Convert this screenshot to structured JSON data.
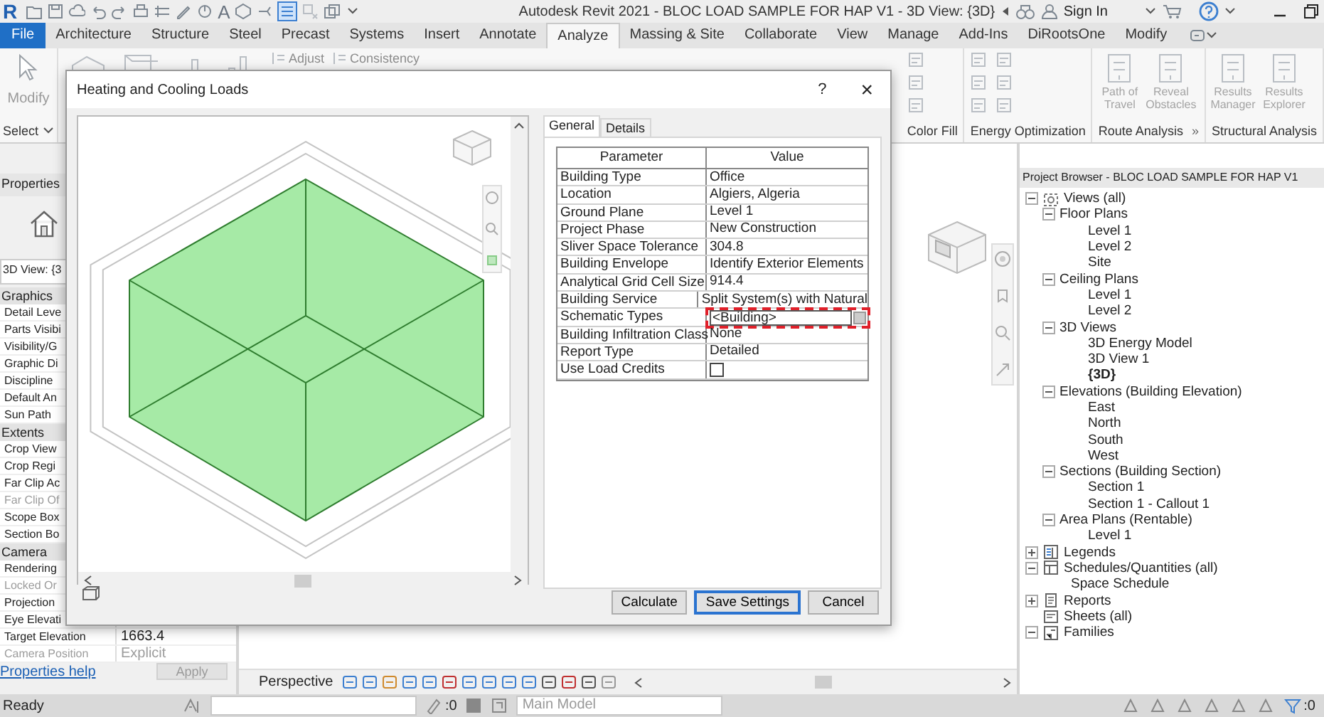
{
  "title_bar": {
    "logo": "R",
    "text_tool": "A",
    "title": "Autodesk Revit 2021 - BLOC LOAD SAMPLE FOR HAP V1 - 3D View: {3D}",
    "sign_in": "Sign In"
  },
  "ribbon_tabs": [
    {
      "label": "File",
      "kind": "app",
      "selected": false
    },
    {
      "label": "Architecture",
      "kind": "tab",
      "selected": false
    },
    {
      "label": "Structure",
      "kind": "tab",
      "selected": false
    },
    {
      "label": "Steel",
      "kind": "tab",
      "selected": false
    },
    {
      "label": "Precast",
      "kind": "tab",
      "selected": false
    },
    {
      "label": "Systems",
      "kind": "tab",
      "selected": false
    },
    {
      "label": "Insert",
      "kind": "tab",
      "selected": false
    },
    {
      "label": "Annotate",
      "kind": "tab",
      "selected": false
    },
    {
      "label": "Analyze",
      "kind": "tab",
      "selected": true
    },
    {
      "label": "Massing & Site",
      "kind": "tab",
      "selected": false
    },
    {
      "label": "Collaborate",
      "kind": "tab",
      "selected": false
    },
    {
      "label": "View",
      "kind": "tab",
      "selected": false
    },
    {
      "label": "Manage",
      "kind": "tab",
      "selected": false
    },
    {
      "label": "Add-Ins",
      "kind": "tab",
      "selected": false
    },
    {
      "label": "DiRootsOne",
      "kind": "tab",
      "selected": false
    },
    {
      "label": "Modify",
      "kind": "tab",
      "selected": false
    }
  ],
  "ribbon": {
    "modify": "Modify",
    "select": "Select",
    "tools": [
      "Adjust",
      "Consistency"
    ],
    "groups": [
      {
        "label": "Color Fill"
      },
      {
        "label": "Energy Optimization"
      },
      {
        "label": "Route Analysis",
        "buttons": [
          "Path of Travel",
          "Reveal Obstacles"
        ],
        "suffix": "»"
      },
      {
        "label": "Structural Analysis",
        "buttons": [
          "Results Manager",
          "Results Explorer"
        ]
      }
    ]
  },
  "properties": {
    "title": "Properties",
    "type": "3D View: {3",
    "groups": [
      {
        "label": "Graphics",
        "rows": [
          {
            "label": "Detail Leve",
            "disabled": false
          },
          {
            "label": "Parts Visibi",
            "disabled": false
          },
          {
            "label": "Visibility/G",
            "disabled": false
          },
          {
            "label": "Graphic Di",
            "disabled": false
          },
          {
            "label": "Discipline",
            "disabled": false
          },
          {
            "label": "Default An",
            "disabled": false
          },
          {
            "label": "Sun Path",
            "disabled": false
          }
        ]
      },
      {
        "label": "Extents",
        "rows": [
          {
            "label": "Crop View",
            "disabled": false
          },
          {
            "label": "Crop Regi",
            "disabled": false
          },
          {
            "label": "Far Clip Ac",
            "disabled": false
          },
          {
            "label": "Far Clip Of",
            "disabled": true
          },
          {
            "label": "Scope Box",
            "disabled": false
          },
          {
            "label": "Section Bo",
            "disabled": false
          }
        ]
      },
      {
        "label": "Camera",
        "rows": [
          {
            "label": "Rendering",
            "disabled": false
          },
          {
            "label": "Locked Or",
            "disabled": true
          },
          {
            "label": "Projection",
            "disabled": false
          },
          {
            "label": "Eye Elevati",
            "disabled": false
          },
          {
            "label": "Target Elevation",
            "value": "1663.4",
            "disabled": false
          },
          {
            "label": "Camera Position",
            "value": "Explicit",
            "disabled": true
          }
        ]
      }
    ],
    "help": "Properties help",
    "apply": "Apply"
  },
  "dialog": {
    "title": "Heating and Cooling Loads",
    "help": "?",
    "close": "×",
    "tabs": [
      {
        "label": "General",
        "selected": true
      },
      {
        "label": "Details",
        "selected": false
      }
    ],
    "columns": [
      "Parameter",
      "Value"
    ],
    "rows": [
      {
        "parameter": "Building Type",
        "value": "Office",
        "kind": "text",
        "highlighted": false
      },
      {
        "parameter": "Location",
        "value": "Algiers, Algeria",
        "kind": "text",
        "highlighted": false
      },
      {
        "parameter": "Ground Plane",
        "value": "Level 1",
        "kind": "text",
        "highlighted": false
      },
      {
        "parameter": "Project Phase",
        "value": "New Construction",
        "kind": "text",
        "highlighted": false
      },
      {
        "parameter": "Sliver Space Tolerance",
        "value": "304.8",
        "kind": "text",
        "highlighted": false
      },
      {
        "parameter": "Building Envelope",
        "value": "Identify Exterior Elements",
        "kind": "text",
        "highlighted": false
      },
      {
        "parameter": "Analytical Grid Cell Size",
        "value": "914.4",
        "kind": "text",
        "highlighted": false
      },
      {
        "parameter": "Building Service",
        "value": "Split System(s) with Natural",
        "kind": "text",
        "highlighted": false
      },
      {
        "parameter": "Schematic Types",
        "value": "<Building>",
        "kind": "browse",
        "highlighted": true
      },
      {
        "parameter": "Building Infiltration Class",
        "value": "None",
        "kind": "text",
        "highlighted": false
      },
      {
        "parameter": "Report Type",
        "value": "Detailed",
        "kind": "text",
        "highlighted": false
      },
      {
        "parameter": "Use Load Credits",
        "kind": "checkbox",
        "checked": false,
        "highlighted": false
      }
    ],
    "buttons": [
      {
        "label": "Calculate",
        "default": false
      },
      {
        "label": "Save Settings",
        "default": true
      },
      {
        "label": "Cancel",
        "default": false
      }
    ]
  },
  "view": {
    "mode": "Perspective"
  },
  "project_browser": {
    "title": "Project Browser - BLOC LOAD SAMPLE FOR HAP V1",
    "tree": [
      {
        "label": "Views (all)",
        "kind": "views",
        "expanded": true,
        "children": [
          {
            "label": "Floor Plans",
            "kind": "folder",
            "expanded": true,
            "children": [
              {
                "label": "Level 1",
                "kind": "view",
                "active": false
              },
              {
                "label": "Level 2",
                "kind": "view",
                "active": false
              },
              {
                "label": "Site",
                "kind": "view",
                "active": false
              }
            ]
          },
          {
            "label": "Ceiling Plans",
            "kind": "folder",
            "expanded": true,
            "children": [
              {
                "label": "Level 1",
                "kind": "view",
                "active": false
              },
              {
                "label": "Level 2",
                "kind": "view",
                "active": false
              }
            ]
          },
          {
            "label": "3D Views",
            "kind": "folder",
            "expanded": true,
            "children": [
              {
                "label": "3D Energy Model",
                "kind": "view",
                "active": false
              },
              {
                "label": "3D View 1",
                "kind": "view",
                "active": false
              },
              {
                "label": "{3D}",
                "kind": "view",
                "active": true
              }
            ]
          },
          {
            "label": "Elevations (Building Elevation)",
            "kind": "folder",
            "expanded": true,
            "children": [
              {
                "label": "East",
                "kind": "view",
                "active": false
              },
              {
                "label": "North",
                "kind": "view",
                "active": false
              },
              {
                "label": "South",
                "kind": "view",
                "active": false
              },
              {
                "label": "West",
                "kind": "view",
                "active": false
              }
            ]
          },
          {
            "label": "Sections (Building Section)",
            "kind": "folder",
            "expanded": true,
            "children": [
              {
                "label": "Section 1",
                "kind": "view",
                "active": false
              },
              {
                "label": "Section 1 - Callout 1",
                "kind": "view",
                "active": false
              }
            ]
          },
          {
            "label": "Area Plans (Rentable)",
            "kind": "folder",
            "expanded": true,
            "children": [
              {
                "label": "Level 1",
                "kind": "view",
                "active": false
              }
            ]
          }
        ]
      },
      {
        "label": "Legends",
        "kind": "legends",
        "expanded": false
      },
      {
        "label": "Schedules/Quantities (all)",
        "kind": "schedules",
        "expanded": true,
        "children": [
          {
            "label": "Space Schedule",
            "kind": "view",
            "active": false
          }
        ]
      },
      {
        "label": "Reports",
        "kind": "reports",
        "expanded": false
      },
      {
        "label": "Sheets (all)",
        "kind": "sheets"
      },
      {
        "label": "Families",
        "kind": "families",
        "expanded": true
      }
    ]
  },
  "status_bar": {
    "text": "Ready",
    "selection_count": ":0",
    "model": "Main Model",
    "filter_count": ":0"
  }
}
